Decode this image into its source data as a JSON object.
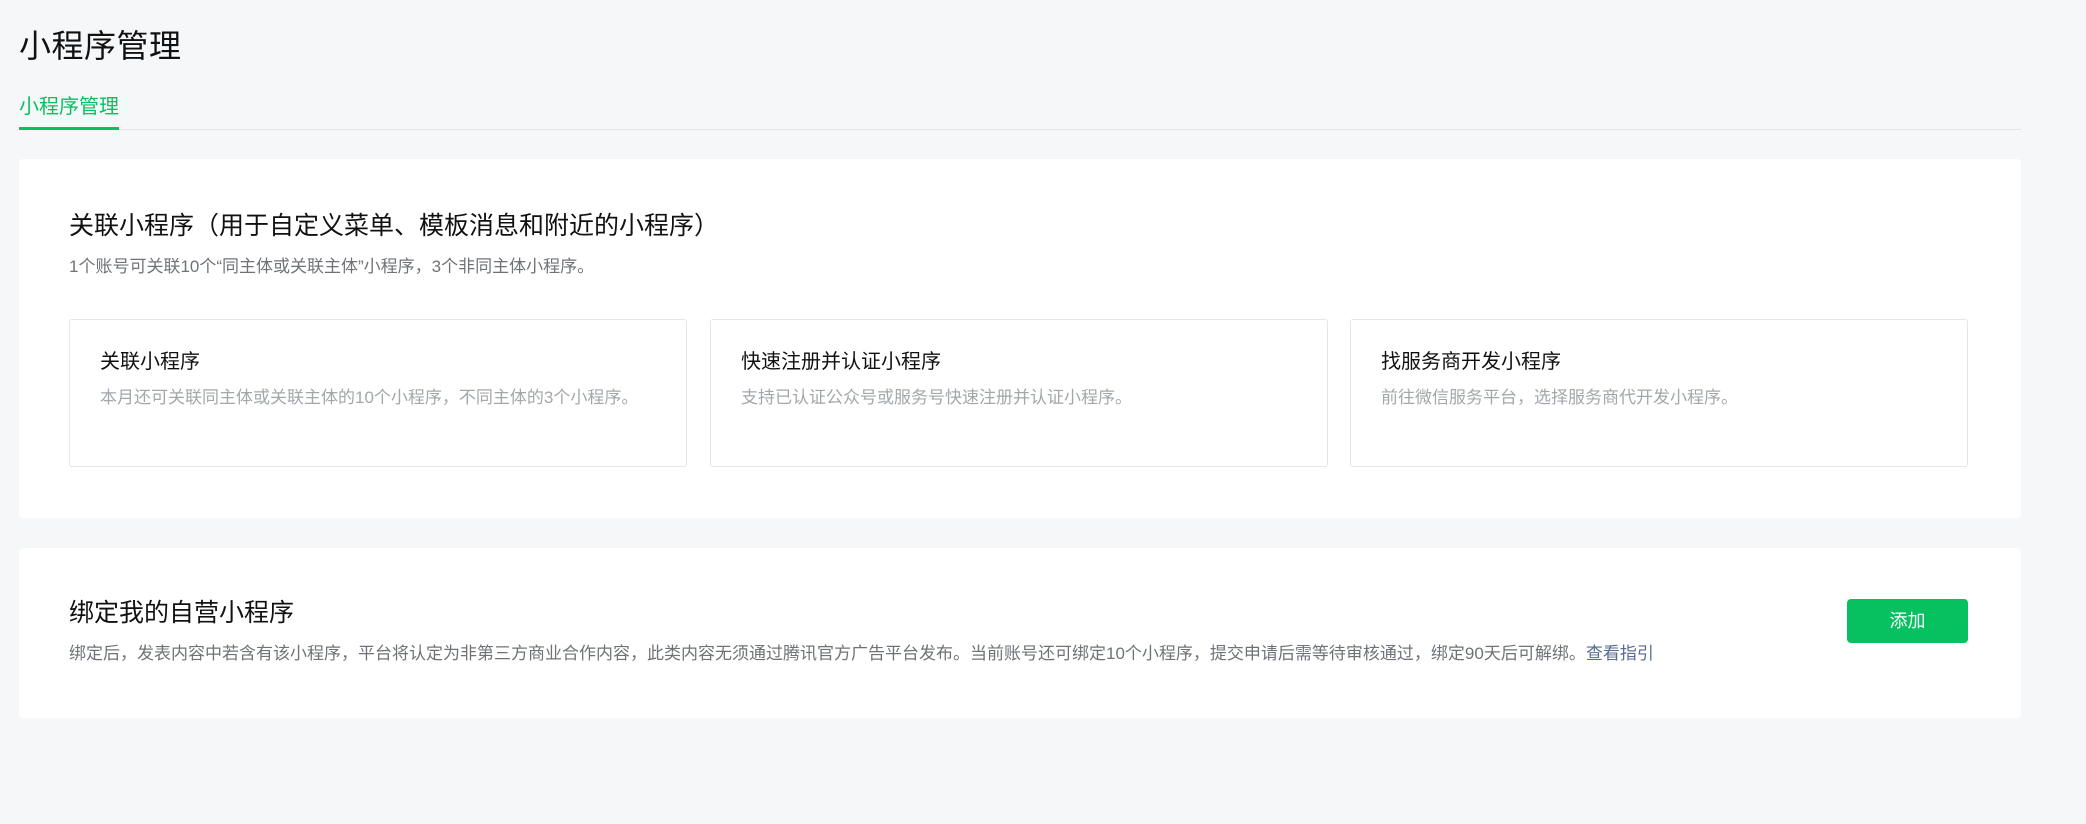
{
  "page": {
    "title": "小程序管理"
  },
  "tabs": [
    {
      "label": "小程序管理",
      "active": true
    }
  ],
  "related_section": {
    "title": "关联小程序（用于自定义菜单、模板消息和附近的小程序）",
    "description": "1个账号可关联10个“同主体或关联主体”小程序，3个非同主体小程序。",
    "options": [
      {
        "title": "关联小程序",
        "description": "本月还可关联同主体或关联主体的10个小程序，不同主体的3个小程序。"
      },
      {
        "title": "快速注册并认证小程序",
        "description": "支持已认证公众号或服务号快速注册并认证小程序。"
      },
      {
        "title": "找服务商开发小程序",
        "description": "前往微信服务平台，选择服务商代开发小程序。"
      }
    ]
  },
  "bind_section": {
    "title": "绑定我的自营小程序",
    "description": "绑定后，发表内容中若含有该小程序，平台将认定为非第三方商业合作内容，此类内容无须通过腾讯官方广告平台发布。当前账号还可绑定10个小程序，提交申请后需等待审核通过，绑定90天后可解绑。",
    "guide_link": "查看指引",
    "add_button": "添加"
  },
  "colors": {
    "accent": "#07c160",
    "link": "#576b95",
    "background": "#f6f7f9",
    "muted_text": "#a3a7ac"
  }
}
